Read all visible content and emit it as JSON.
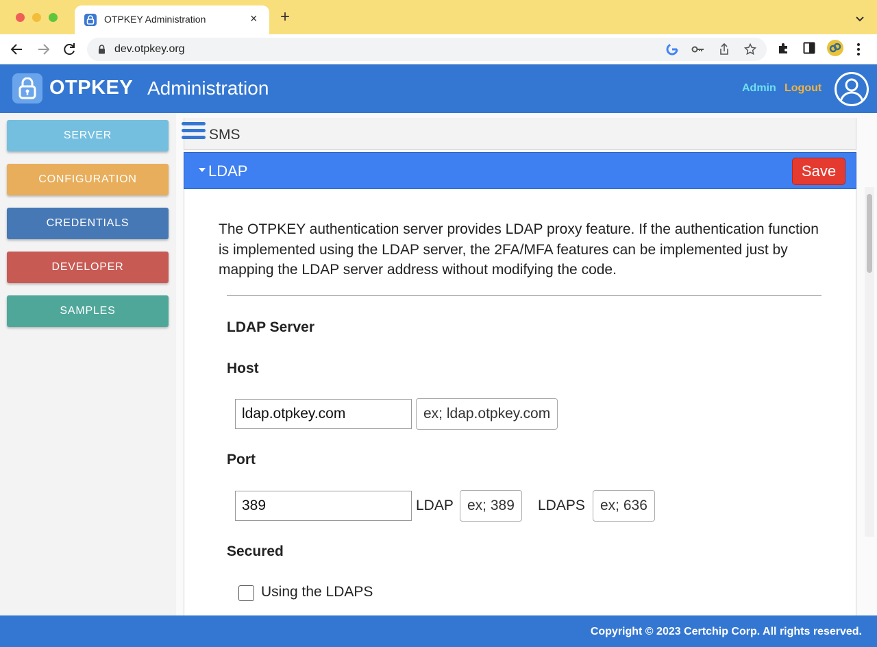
{
  "browser": {
    "tab_title": "OTPKEY Administration",
    "tab_close": "×",
    "new_tab": "+",
    "url": "dev.otpkey.org"
  },
  "header": {
    "brand": "OTPKEY",
    "title": "Administration",
    "admin_link": "Admin",
    "logout_link": "Logout"
  },
  "sidebar": {
    "items": [
      {
        "label": "SERVER",
        "color": "#74bfe0"
      },
      {
        "label": "CONFIGURATION",
        "color": "#e8ae5b"
      },
      {
        "label": "CREDENTIALS",
        "color": "#4678b6"
      },
      {
        "label": "DEVELOPER",
        "color": "#c85a54"
      },
      {
        "label": "SAMPLES",
        "color": "#4fa79a"
      }
    ]
  },
  "main": {
    "sms_panel": "SMS",
    "ldap_panel": {
      "title": "LDAP",
      "save_label": "Save",
      "description": "The OTPKEY authentication server provides LDAP proxy feature. If the authentication function is implemented using the LDAP server, the 2FA/MFA features can be implemented just by mapping the LDAP server address without modifying the code.",
      "section_title": "LDAP Server",
      "host": {
        "label": "Host",
        "value": "ldap.otpkey.com",
        "hint": "ex; ldap.otpkey.com"
      },
      "port": {
        "label": "Port",
        "value": "389",
        "ldap_label": "LDAP",
        "ldap_hint": "ex; 389",
        "ldaps_label": "LDAPS",
        "ldaps_hint": "ex; 636"
      },
      "secured": {
        "label": "Secured",
        "checkbox_label": "Using the LDAPS",
        "checked": false
      }
    }
  },
  "footer": {
    "copyright": "Copyright © 2023 Certchip Corp. All rights reserved."
  },
  "colors": {
    "header_bg": "#3477d2",
    "ldap_header_bg": "#3e7ff2",
    "save_button": "#e53a2f",
    "admin_link": "#6fe0f0",
    "logout_link": "#f3b33d",
    "tabbar_bg": "#f9de7c"
  }
}
